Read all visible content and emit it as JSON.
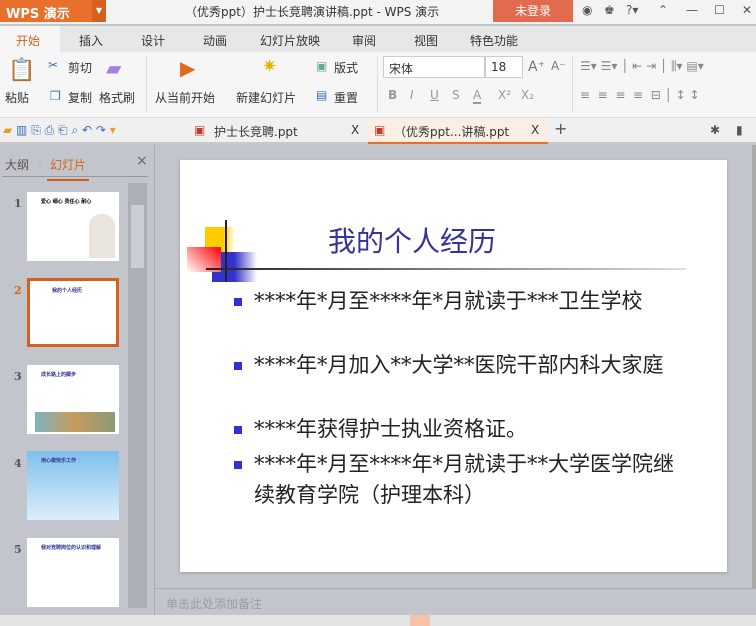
{
  "app": {
    "logo": "WPS 演示",
    "window_title": "（优秀ppt）护士长竞聘演讲稿.ppt - WPS 演示",
    "login": "未登录"
  },
  "menu_tabs": [
    "开始",
    "插入",
    "设计",
    "动画",
    "幻灯片放映",
    "审阅",
    "视图",
    "特色功能"
  ],
  "ribbon": {
    "paste": "粘贴",
    "cut": "剪切",
    "copy": "复制",
    "format_painter": "格式刷",
    "from_current": "从当前开始",
    "new_slide": "新建幻灯片",
    "layout": "版式",
    "reset": "重置",
    "font": "宋体",
    "font_size": "18",
    "bold": "B",
    "italic": "I",
    "underline": "U",
    "shadow": "S",
    "font_color": "A"
  },
  "doc_tabs": [
    {
      "label": "护士长竞聘.ppt",
      "close": "X"
    },
    {
      "label": "（优秀ppt...讲稿.ppt",
      "close": "X"
    }
  ],
  "left_panel": {
    "tab_outline": "大纲",
    "tab_slides": "幻灯片",
    "close": "×",
    "slides": [
      {
        "n": "1",
        "title": "爱心 细心 责任心 耐心"
      },
      {
        "n": "2",
        "title": "我的个人经历"
      },
      {
        "n": "3",
        "title": "成长路上的脚步"
      },
      {
        "n": "4",
        "title": "用心做快乐工作"
      },
      {
        "n": "5",
        "title": "我对竞聘岗位的认识和理解"
      }
    ]
  },
  "slide": {
    "title": "我的个人经历",
    "bullets": [
      "****年*月至****年*月就读于***卫生学校",
      "****年*月加入**大学**医院干部内科大家庭",
      "****年获得护士执业资格证。",
      "****年*月至****年*月就读于**大学医学院继续教育学院（护理本科）"
    ]
  },
  "notes_placeholder": "单击此处添加备注",
  "colors": {
    "accent": "#e8702a",
    "title": "#333399"
  }
}
